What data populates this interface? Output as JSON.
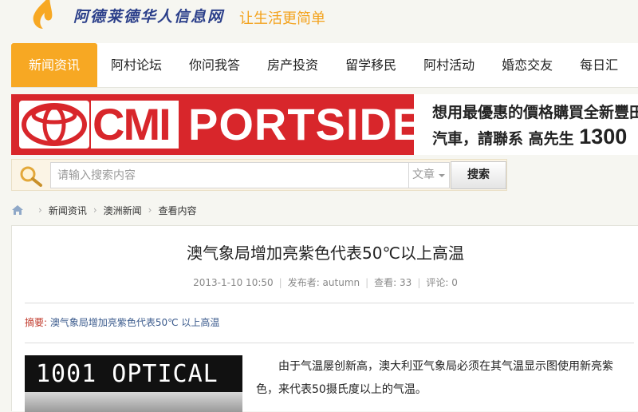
{
  "header": {
    "logo_text": "阿德莱德华人信息网",
    "slogan": "让生活更简单",
    "logo_icon": "flame-logo-icon"
  },
  "nav": {
    "items": [
      {
        "label": "新闻资讯",
        "active": true
      },
      {
        "label": "阿村论坛",
        "active": false
      },
      {
        "label": "你问我答",
        "active": false
      },
      {
        "label": "房产投资",
        "active": false
      },
      {
        "label": "留学移民",
        "active": false
      },
      {
        "label": "阿村活动",
        "active": false
      },
      {
        "label": "婚恋交友",
        "active": false
      },
      {
        "label": "每日汇",
        "active": false
      }
    ]
  },
  "banner": {
    "brand_logo": "toyota-logo-icon",
    "cmi": "CMI",
    "portside": "PORTSIDE",
    "line1": "想用最優惠的價格購買全新豐田",
    "line2": "汽車，請聯系 高先生",
    "phone": "1300"
  },
  "search": {
    "placeholder": "请输入搜索内容",
    "category": "文章",
    "button_label": "搜索"
  },
  "breadcrumb": {
    "items": [
      "新闻资讯",
      "澳洲新闻",
      "查看内容"
    ]
  },
  "article": {
    "title": "澳气象局增加亮紫色代表50℃以上高温",
    "date": "2013-1-10 10:50",
    "author": "发布者: autumn",
    "views": "查看: 33",
    "comments": "评论: 0",
    "summary_label": "摘要: ",
    "summary": "澳气象局增加亮紫色代表50℃ 以上高温",
    "image_text": "1001 OPTICAL",
    "body": "由于气温屡创新高，澳大利亚气象局必须在其气温显示图使用新亮紫色，来代表50摄氏度以上的气温。"
  },
  "colors": {
    "accent": "#f7a823",
    "brand_blue": "#2b3f8a",
    "banner_red": "#d8262b",
    "summary_label": "#c0392b",
    "summary_text": "#3a5a8c"
  }
}
